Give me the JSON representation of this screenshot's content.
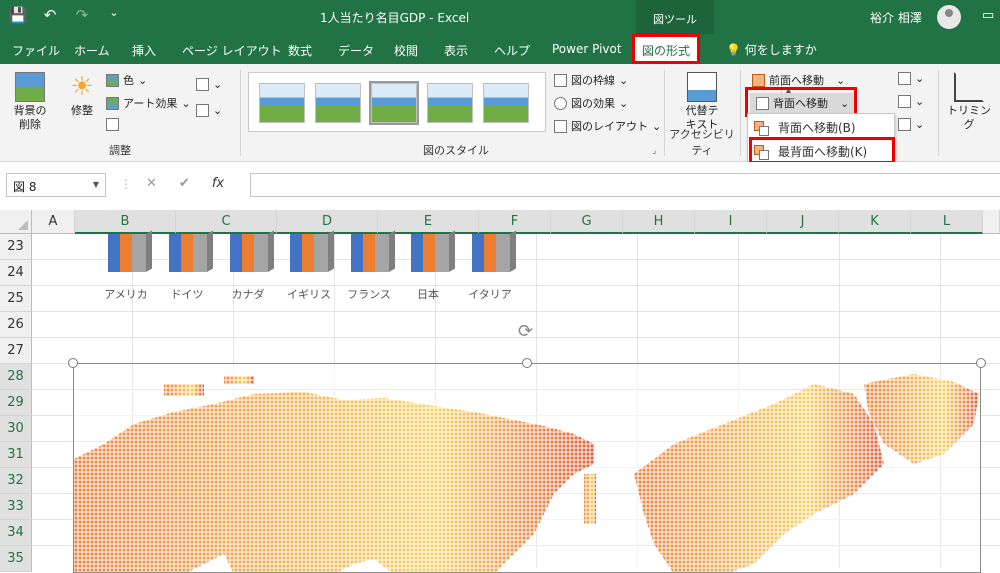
{
  "titlebar": {
    "doc_title": "1人当たり名目GDP  -  Excel",
    "tool_label": "図ツール",
    "user_name": "裕介 相澤",
    "save_icon": "save-icon",
    "undo_icon": "undo-icon",
    "redo_icon": "redo-icon"
  },
  "tabs": [
    {
      "label": "ファイル"
    },
    {
      "label": "ホーム"
    },
    {
      "label": "挿入"
    },
    {
      "label": "ページ レイアウト"
    },
    {
      "label": "数式"
    },
    {
      "label": "データ"
    },
    {
      "label": "校閲"
    },
    {
      "label": "表示"
    },
    {
      "label": "ヘルプ"
    },
    {
      "label": "Power Pivot"
    },
    {
      "label": "図の形式"
    }
  ],
  "tell_me": "何をしますか",
  "ribbon": {
    "remove_bg": "背景の\n削除",
    "adjust": "修整",
    "color": "色",
    "artistic": "アート効果",
    "group_adjust": "調整",
    "border": "図の枠線",
    "effects": "図の効果",
    "layout": "図のレイアウト",
    "group_styles": "図のスタイル",
    "alt_text": "代替テ\nキスト",
    "group_accessibility": "アクセシビリティ",
    "bring_forward": "前面へ移動",
    "send_backward": "背面へ移動",
    "crop": "トリミング"
  },
  "dropdown": {
    "item1": "背面へ移動(B)",
    "item2": "最背面へ移動(K)"
  },
  "formula": {
    "namebox": "図 8",
    "cancel": "✕",
    "enter": "✔",
    "fx": "fx"
  },
  "columns": [
    "A",
    "B",
    "C",
    "D",
    "E",
    "F",
    "G",
    "H",
    "I",
    "J",
    "K",
    "L"
  ],
  "rows": [
    "23",
    "24",
    "25",
    "26",
    "27",
    "28",
    "29",
    "30",
    "31",
    "32",
    "33",
    "34",
    "35"
  ],
  "countries": [
    "アメリカ",
    "ドイツ",
    "カナダ",
    "イギリス",
    "フランス",
    "日本",
    "イタリア"
  ]
}
